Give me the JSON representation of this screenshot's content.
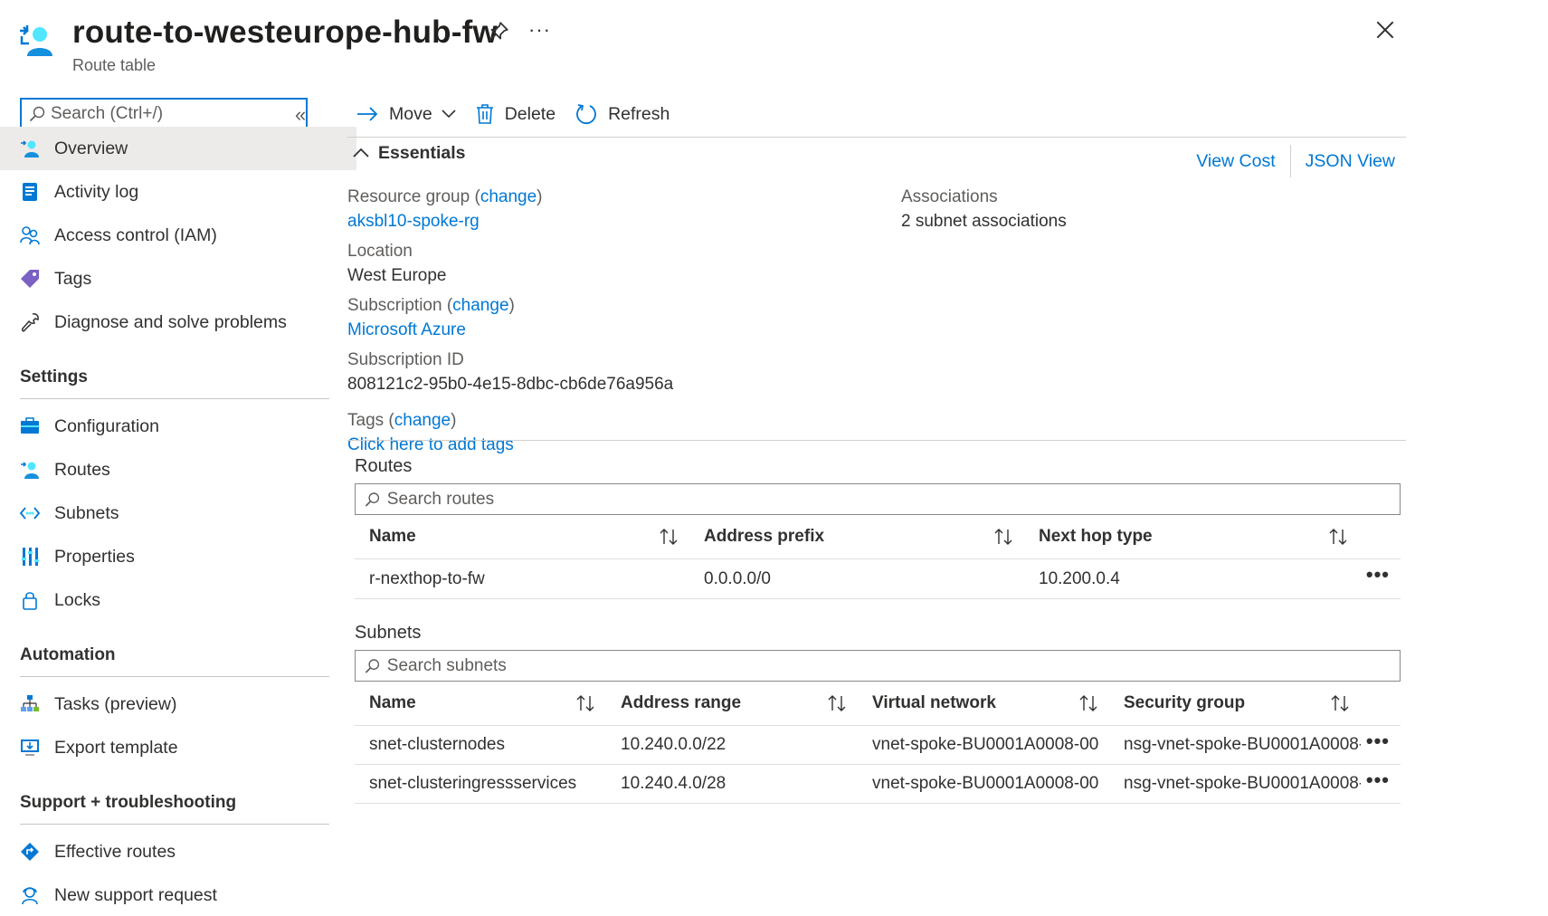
{
  "header": {
    "title": "route-to-westeurope-hub-fw",
    "subtitle": "Route table",
    "more_label": "···"
  },
  "sidebar": {
    "search_placeholder": "Search (Ctrl+/)",
    "collapse_label": "«",
    "top_items": [
      {
        "label": "Overview",
        "icon": "route-table-icon",
        "active": true
      },
      {
        "label": "Activity log",
        "icon": "activity-log-icon"
      },
      {
        "label": "Access control (IAM)",
        "icon": "iam-icon"
      },
      {
        "label": "Tags",
        "icon": "tag-icon"
      },
      {
        "label": "Diagnose and solve problems",
        "icon": "wrench-icon"
      }
    ],
    "sections": [
      {
        "title": "Settings",
        "items": [
          {
            "label": "Configuration",
            "icon": "configuration-icon"
          },
          {
            "label": "Routes",
            "icon": "routes-icon"
          },
          {
            "label": "Subnets",
            "icon": "subnets-icon"
          },
          {
            "label": "Properties",
            "icon": "properties-icon"
          },
          {
            "label": "Locks",
            "icon": "lock-icon"
          }
        ]
      },
      {
        "title": "Automation",
        "items": [
          {
            "label": "Tasks (preview)",
            "icon": "tasks-icon"
          },
          {
            "label": "Export template",
            "icon": "export-template-icon"
          }
        ]
      },
      {
        "title": "Support + troubleshooting",
        "items": [
          {
            "label": "Effective routes",
            "icon": "effective-routes-icon"
          },
          {
            "label": "New support request",
            "icon": "support-icon"
          }
        ]
      }
    ]
  },
  "toolbar": {
    "move_label": "Move",
    "delete_label": "Delete",
    "refresh_label": "Refresh"
  },
  "essentials": {
    "title": "Essentials",
    "view_cost": "View Cost",
    "json_view": "JSON View",
    "resource_group_label": "Resource group",
    "change_label": "change",
    "resource_group_value": "aksbl10-spoke-rg",
    "location_label": "Location",
    "location_value": "West Europe",
    "subscription_label": "Subscription",
    "subscription_value": "Microsoft Azure",
    "subscription_id_label": "Subscription ID",
    "subscription_id_value": "808121c2-95b0-4e15-8dbc-cb6de76a956a",
    "tags_label": "Tags",
    "tags_value": "Click here to add tags",
    "associations_label": "Associations",
    "associations_value": "2 subnet associations"
  },
  "routes": {
    "title": "Routes",
    "search_placeholder": "Search routes",
    "columns": [
      "Name",
      "Address prefix",
      "Next hop type"
    ],
    "rows": [
      [
        "r-nexthop-to-fw",
        "0.0.0.0/0",
        "10.200.0.4"
      ]
    ]
  },
  "subnets": {
    "title": "Subnets",
    "search_placeholder": "Search subnets",
    "columns": [
      "Name",
      "Address range",
      "Virtual network",
      "Security group"
    ],
    "rows": [
      [
        "snet-clusternodes",
        "10.240.0.0/22",
        "vnet-spoke-BU0001A0008-00",
        "nsg-vnet-spoke-BU0001A0008-..."
      ],
      [
        "snet-clusteringressservices",
        "10.240.4.0/28",
        "vnet-spoke-BU0001A0008-00",
        "nsg-vnet-spoke-BU0001A0008-..."
      ]
    ]
  },
  "colors": {
    "accent": "#0078d4",
    "active_nav": "#edebe9",
    "text": "#323130",
    "muted": "#605e5c"
  }
}
